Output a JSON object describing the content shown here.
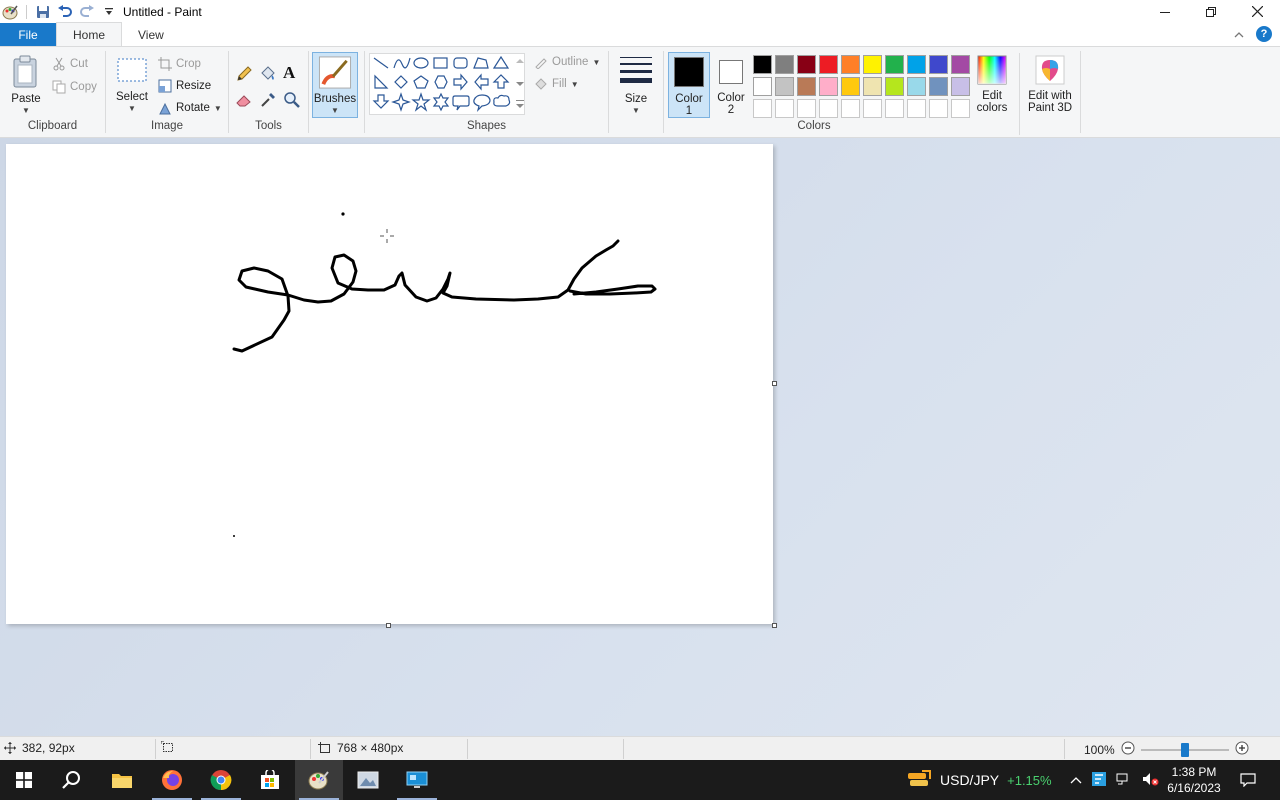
{
  "window": {
    "title": "Untitled - Paint"
  },
  "tabs": [
    "File",
    "Home",
    "View"
  ],
  "ribbon": {
    "clipboard": {
      "label": "Clipboard",
      "paste": "Paste",
      "cut": "Cut",
      "copy": "Copy"
    },
    "image": {
      "label": "Image",
      "select": "Select",
      "crop": "Crop",
      "resize": "Resize",
      "rotate": "Rotate"
    },
    "tools": {
      "label": "Tools"
    },
    "brushes": {
      "label": "Brushes"
    },
    "shapes": {
      "label": "Shapes",
      "outline": "Outline",
      "fill": "Fill"
    },
    "size": {
      "label": "Size"
    },
    "colors": {
      "label": "Colors",
      "color1": "Color\n1",
      "color1_a": "Color",
      "color1_b": "1",
      "color2_a": "Color",
      "color2_b": "2",
      "edit_a": "Edit",
      "edit_b": "colors",
      "paint3d_a": "Edit with",
      "paint3d_b": "Paint 3D",
      "color1_value": "#000000",
      "color2_value": "#ffffff",
      "palette_row1": [
        "#000000",
        "#7f7f7f",
        "#880015",
        "#ed1c24",
        "#ff7f27",
        "#fff200",
        "#22b14c",
        "#00a2e8",
        "#3f48cc",
        "#a349a4"
      ],
      "palette_row2": [
        "#ffffff",
        "#c3c3c3",
        "#b97a57",
        "#ffaec9",
        "#ffc90e",
        "#efe4b0",
        "#b5e61d",
        "#99d9ea",
        "#7092be",
        "#c8bfe7"
      ],
      "palette_row3": [
        "#ffffff",
        "#ffffff",
        "#ffffff",
        "#ffffff",
        "#ffffff",
        "#ffffff",
        "#ffffff",
        "#ffffff",
        "#ffffff",
        "#ffffff"
      ]
    }
  },
  "status": {
    "cursor_pos": "382, 92px",
    "canvas_size": "768 × 480px",
    "zoom": "100%",
    "zoom_fraction": 0.5
  },
  "taskbar": {
    "ticker": "USD/JPY",
    "ticker_change": "+1.15%",
    "time": "1:38 PM",
    "date": "6/16/2023"
  }
}
